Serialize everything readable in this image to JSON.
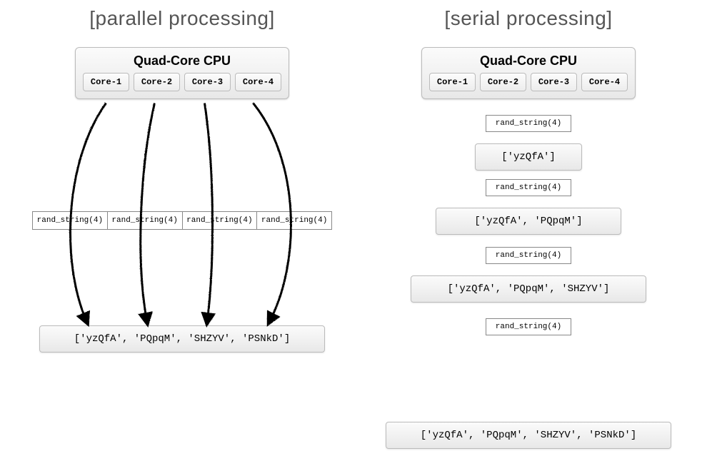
{
  "left": {
    "title": "[parallel processing]",
    "cpu_title": "Quad-Core CPU",
    "cores": [
      "Core-1",
      "Core-2",
      "Core-3",
      "Core-4"
    ],
    "calls": [
      "rand_string(4)",
      "rand_string(4)",
      "rand_string(4)",
      "rand_string(4)"
    ],
    "result": "['yzQfA', 'PQpqM', 'SHZYV', 'PSNkD']"
  },
  "right": {
    "title": "[serial processing]",
    "cpu_title": "Quad-Core CPU",
    "cores": [
      "Core-1",
      "Core-2",
      "Core-3",
      "Core-4"
    ],
    "steps": [
      {
        "call": "rand_string(4)",
        "result": "['yzQfA']"
      },
      {
        "call": "rand_string(4)",
        "result": "['yzQfA', 'PQpqM']"
      },
      {
        "call": "rand_string(4)",
        "result": "['yzQfA', 'PQpqM', 'SHZYV']"
      },
      {
        "call": "rand_string(4)",
        "result": "['yzQfA', 'PQpqM', 'SHZYV', 'PSNkD']"
      }
    ]
  }
}
